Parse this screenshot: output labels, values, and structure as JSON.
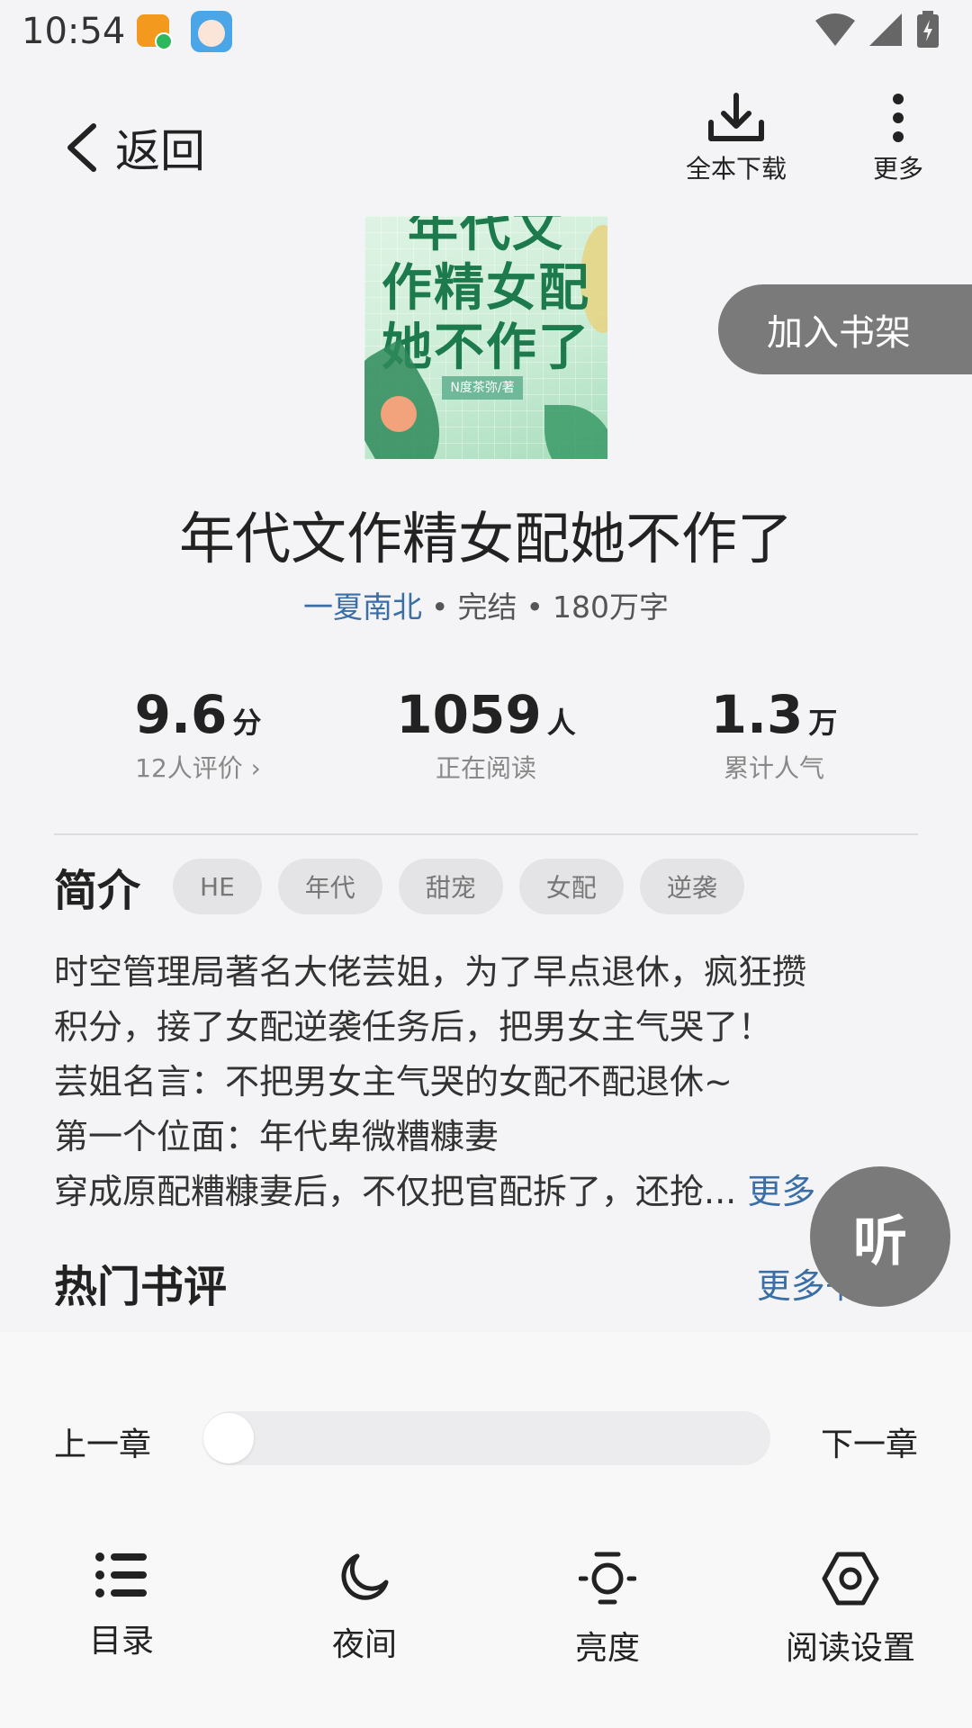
{
  "status_bar": {
    "time": "10:54"
  },
  "top_bar": {
    "back_label": "返回",
    "download_label": "全本下载",
    "more_label": "更多"
  },
  "cover": {
    "title_line1": "年代文",
    "title_line2": "作精女配",
    "title_line3": "她不作了",
    "author_tag": "N度茶弥/著"
  },
  "shelf_button": "加入书架",
  "book": {
    "title": "年代文作精女配她不作了",
    "author": "一夏南北",
    "status": "完结",
    "words": "180万字",
    "dot": "•"
  },
  "stats": [
    {
      "value": "9.6",
      "unit": "分",
      "label": "12人评价",
      "chevron": "›"
    },
    {
      "value": "1059",
      "unit": "人",
      "label": "正在阅读"
    },
    {
      "value": "1.3",
      "unit": "万",
      "label": "累计人气"
    }
  ],
  "intro": {
    "title": "简介",
    "tags": [
      "HE",
      "年代",
      "甜宠",
      "女配",
      "逆袭"
    ],
    "lines": [
      "时空管理局著名大佬芸姐，为了早点退休，疯狂攒",
      "积分，接了女配逆袭任务后，把男女主气哭了！",
      "芸姐名言：不把男女主气哭的女配不配退休~",
      "第一个位面：年代卑微糟糠妻",
      "穿成原配糟糠妻后，不仅把官配拆了，还抢..."
    ],
    "more": "更多"
  },
  "listen_button": "听",
  "reviews": {
    "title": "热门书评",
    "more": "更多书评 ›"
  },
  "reader": {
    "prev_chapter": "上一章",
    "next_chapter": "下一章",
    "progress": 0.0,
    "tools": [
      {
        "label": "目录",
        "icon": "list-icon"
      },
      {
        "label": "夜间",
        "icon": "moon-icon"
      },
      {
        "label": "亮度",
        "icon": "bulb-icon"
      },
      {
        "label": "阅读设置",
        "icon": "hexagon-settings-icon"
      }
    ]
  },
  "colors": {
    "accent": "#3a6ea5",
    "button_gray": "#7a7a7a"
  }
}
